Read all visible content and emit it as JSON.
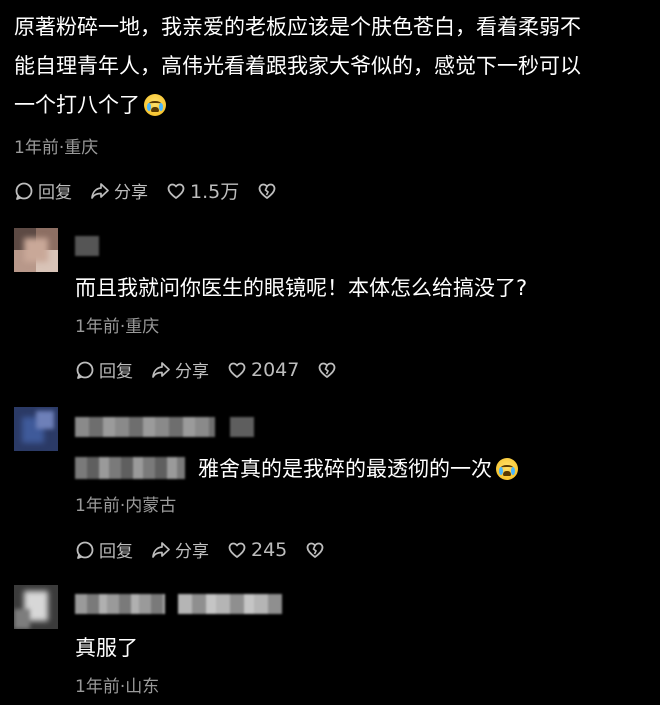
{
  "top_comment": {
    "lines": [
      "原著粉碎一地，我亲爱的老板应该是个肤色苍白，看着柔弱不",
      "能自理青年人，高伟光看着跟我家大爷似的，感觉下一秒可以",
      "一个打八个了"
    ],
    "emoji_icon": "crying-face-emoji",
    "meta": "1年前·重庆",
    "actions": {
      "reply": "回复",
      "share": "分享",
      "likes": "1.5万"
    }
  },
  "replies": [
    {
      "text": "而且我就问你医生的眼镜呢！本体怎么给搞没了?",
      "meta": "1年前·重庆",
      "actions": {
        "reply": "回复",
        "share": "分享",
        "likes": "2047"
      }
    },
    {
      "text": "雅舍真的是我碎的最透彻的一次",
      "emoji_icon": "crying-face-emoji",
      "meta": "1年前·内蒙古",
      "actions": {
        "reply": "回复",
        "share": "分享",
        "likes": "245"
      }
    },
    {
      "text": "真服了",
      "meta": "1年前·山东"
    }
  ],
  "colors": {
    "background": "#000000",
    "text": "#ffffff",
    "meta": "#9a9a9a",
    "action": "#bdbdbd"
  }
}
